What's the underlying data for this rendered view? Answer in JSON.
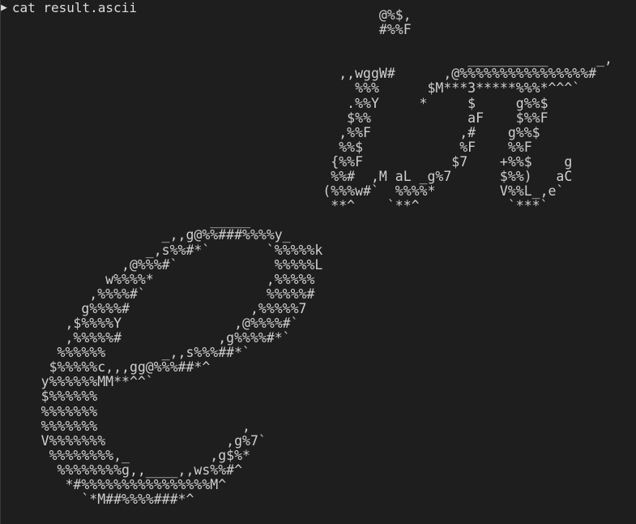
{
  "terminal": {
    "prompt_symbol": "▶",
    "command": "cat result.ascii"
  },
  "ascii_art": "                                               @%$,\n                                               #%%F\n\n                                                          __________      _,\n                                          ,,wggW#      ,@%%%%%%%%%%%%%%%%#\n                                            %%%      $M***3*****%%%*^^^`\n                                           .%%Y     *     $     g%%$\n                                           $%%            aF    $%%F\n                                          ,%%F           ,#    g%%$\n                                          %%$            %F    %%F\n                                         {%%F           $7    +%%$    g\n                                         %%#  ,M aL _g%7      $%%)   aC\n                                        (%%%w#`  %%%%*        V%%L_,e`\n                                         **^    `**^           `***`\n                          _____\n                    _,,g@%%###%%%%y_\n                  _,s%%#*`       `%%%%%k\n               ,@%%%#`            %%%%%L\n             w%%%%*              ,%%%%%\n           ,%%%%#`               %%%%%#\n          g%%%%#               ,%%%%%7\n        ,$%%%%Y              ,@%%%%#`\n        ,%%%%%#            ,g%%%%#*`\n       %%%%%%       _,,s%%%##*`\n      $%%%%%c,,,gg@%%%##*^\n     y%%%%%%MM**^^`\n     $%%%%%%\n     %%%%%%%\n     %%%%%%%                  ,\n     V%%%%%%%               ,g%7`\n      %%%%%%%%,_          ,g$%*\n       %%%%%%%%g,,____,,ws%%#^\n        *#%%%%%%%%%%%%%%%%M^\n          `*M##%%%%###*^"
}
